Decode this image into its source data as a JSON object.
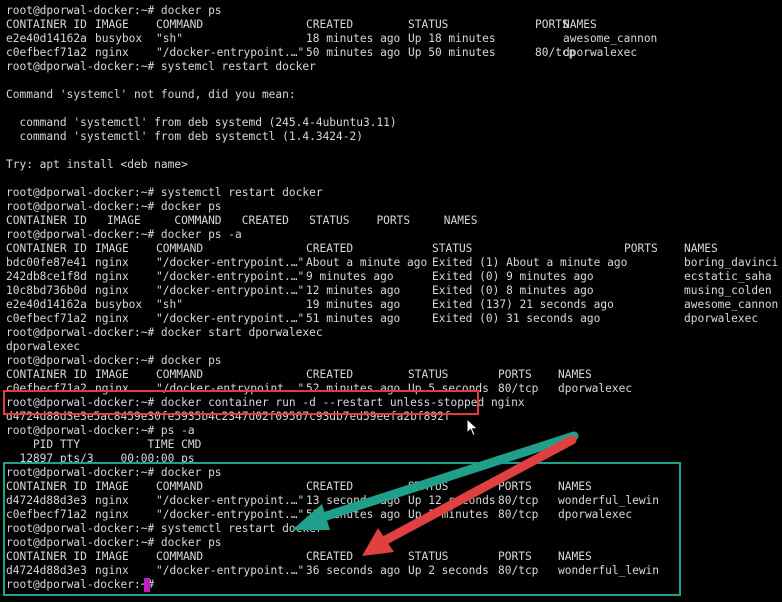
{
  "colors": {
    "background": "#000000",
    "foreground": "#d8d8d8",
    "cursor": "#c020c0",
    "highlight_red": "#e23b3b",
    "highlight_green": "#20a08a",
    "arrow_green": "#20a08a",
    "arrow_red": "#e04040"
  },
  "icons": {
    "mouse_pointer": "arrow-cursor-icon",
    "green_arrow": "arrow-annotation-icon",
    "red_arrow": "arrow-annotation-icon"
  },
  "terminal": {
    "lines": [
      {
        "cells": [
          {
            "t": "root@dporwal-docker:~# docker ps"
          }
        ]
      },
      {
        "cells": [
          {
            "t": "CONTAINER ID"
          },
          {
            "t": "IMAGE"
          },
          {
            "t": "COMMAND"
          },
          {
            "t": "CREATED"
          },
          {
            "t": "STATUS"
          },
          {
            "t": "PORTS"
          },
          {
            "t": "NAMES"
          }
        ]
      },
      {
        "cells": [
          {
            "t": "e2e40d14162a"
          },
          {
            "t": "busybox"
          },
          {
            "t": "\"sh\""
          },
          {
            "t": "18 minutes ago"
          },
          {
            "t": "Up 18 minutes"
          },
          {
            "t": "awesome_cannon"
          }
        ]
      },
      {
        "cells": [
          {
            "t": "c0efbecf71a2"
          },
          {
            "t": "nginx"
          },
          {
            "t": "\"/docker-entrypoint.…\""
          },
          {
            "t": "50 minutes ago"
          },
          {
            "t": "Up 50 minutes"
          },
          {
            "t": "80/tcp"
          },
          {
            "t": "dporwalexec"
          }
        ]
      },
      {
        "cells": [
          {
            "t": "root@dporwal-docker:~# systemcl restart docker"
          }
        ]
      },
      {
        "cells": []
      },
      {
        "cells": [
          {
            "t": "Command 'systemcl' not found, did you mean:"
          }
        ]
      },
      {
        "cells": []
      },
      {
        "cells": [
          {
            "t": "  command 'systemctl' from deb systemd (245.4-4ubuntu3.11)"
          }
        ]
      },
      {
        "cells": [
          {
            "t": "  command 'systemctl' from deb systemctl (1.4.3424-2)"
          }
        ]
      },
      {
        "cells": []
      },
      {
        "cells": [
          {
            "t": "Try: apt install <deb name>"
          }
        ]
      },
      {
        "cells": []
      },
      {
        "cells": [
          {
            "t": "root@dporwal-docker:~# systemctl restart docker"
          }
        ]
      },
      {
        "cells": [
          {
            "t": "root@dporwal-docker:~# docker ps"
          }
        ]
      },
      {
        "cells": [
          {
            "t": "CONTAINER ID   IMAGE     COMMAND   CREATED   STATUS    PORTS     NAMES"
          }
        ]
      },
      {
        "cells": [
          {
            "t": "root@dporwal-docker:~# docker ps -a"
          }
        ]
      },
      {
        "cells": [
          {
            "t": "CONTAINER ID"
          },
          {
            "t": "IMAGE"
          },
          {
            "t": "COMMAND"
          },
          {
            "t": "CREATED"
          },
          {
            "t": "STATUS"
          },
          {
            "t": "PORTS"
          },
          {
            "t": "NAMES"
          }
        ]
      },
      {
        "cells": [
          {
            "t": "bdc00fe87e41"
          },
          {
            "t": "nginx"
          },
          {
            "t": "\"/docker-entrypoint.…\""
          },
          {
            "t": "About a minute ago"
          },
          {
            "t": "Exited (1) About a minute ago"
          },
          {
            "t": "boring_davinci"
          }
        ]
      },
      {
        "cells": [
          {
            "t": "242db8ce1f8d"
          },
          {
            "t": "nginx"
          },
          {
            "t": "\"/docker-entrypoint.…\""
          },
          {
            "t": "9 minutes ago"
          },
          {
            "t": "Exited (0) 9 minutes ago"
          },
          {
            "t": "ecstatic_saha"
          }
        ]
      },
      {
        "cells": [
          {
            "t": "10c8bd736b0d"
          },
          {
            "t": "nginx"
          },
          {
            "t": "\"/docker-entrypoint.…\""
          },
          {
            "t": "12 minutes ago"
          },
          {
            "t": "Exited (0) 8 minutes ago"
          },
          {
            "t": "musing_colden"
          }
        ]
      },
      {
        "cells": [
          {
            "t": "e2e40d14162a"
          },
          {
            "t": "busybox"
          },
          {
            "t": "\"sh\""
          },
          {
            "t": "19 minutes ago"
          },
          {
            "t": "Exited (137) 21 seconds ago"
          },
          {
            "t": "awesome_cannon"
          }
        ]
      },
      {
        "cells": [
          {
            "t": "c0efbecf71a2"
          },
          {
            "t": "nginx"
          },
          {
            "t": "\"/docker-entrypoint.…\""
          },
          {
            "t": "51 minutes ago"
          },
          {
            "t": "Exited (0) 31 seconds ago"
          },
          {
            "t": "dporwalexec"
          }
        ]
      },
      {
        "cells": [
          {
            "t": "root@dporwal-docker:~# docker start dporwalexec"
          }
        ]
      },
      {
        "cells": [
          {
            "t": "dporwalexec"
          }
        ]
      },
      {
        "cells": [
          {
            "t": "root@dporwal-docker:~# docker ps"
          }
        ]
      },
      {
        "cells": [
          {
            "t": "CONTAINER ID"
          },
          {
            "t": "IMAGE"
          },
          {
            "t": "COMMAND"
          },
          {
            "t": "CREATED"
          },
          {
            "t": "STATUS"
          },
          {
            "t": "PORTS"
          },
          {
            "t": "NAMES"
          }
        ]
      },
      {
        "cells": [
          {
            "t": "c0efbecf71a2"
          },
          {
            "t": "nginx"
          },
          {
            "t": "\"/docker-entrypoint.…\""
          },
          {
            "t": "52 minutes ago"
          },
          {
            "t": "Up 5 seconds"
          },
          {
            "t": "80/tcp"
          },
          {
            "t": "dporwalexec"
          }
        ]
      },
      {
        "cells": [
          {
            "t": "root@dporwal-docker:~# docker container run -d --restart unless-stopped nginx"
          }
        ]
      },
      {
        "cells": [
          {
            "t": "d4724d88d3e3e5ac8459e30fe5935b4c2347d02f09567c93db7ed59eefa2bf892f"
          }
        ]
      },
      {
        "cells": [
          {
            "t": "root@dporwal-docker:~# ps -a"
          }
        ]
      },
      {
        "cells": [
          {
            "t": "    PID TTY          TIME CMD"
          }
        ]
      },
      {
        "cells": [
          {
            "t": "  12897 pts/3    00:00:00 ps"
          }
        ]
      },
      {
        "cells": [
          {
            "t": "root@dporwal-docker:~# docker ps"
          }
        ]
      },
      {
        "cells": [
          {
            "t": "CONTAINER ID"
          },
          {
            "t": "IMAGE"
          },
          {
            "t": "COMMAND"
          },
          {
            "t": "CREATED"
          },
          {
            "t": "STATUS"
          },
          {
            "t": "PORTS"
          },
          {
            "t": "NAMES"
          }
        ]
      },
      {
        "cells": [
          {
            "t": "d4724d88d3e3"
          },
          {
            "t": "nginx"
          },
          {
            "t": "\"/docker-entrypoint.…\""
          },
          {
            "t": "13 seconds ago"
          },
          {
            "t": "Up 12 seconds"
          },
          {
            "t": "80/tcp"
          },
          {
            "t": "wonderful_lewin"
          }
        ]
      },
      {
        "cells": [
          {
            "t": "c0efbecf71a2"
          },
          {
            "t": "nginx"
          },
          {
            "t": "\"/docker-entrypoint.…\""
          },
          {
            "t": "52 minutes ago"
          },
          {
            "t": "Up 3 minutes"
          },
          {
            "t": "80/tcp"
          },
          {
            "t": "dporwalexec"
          }
        ]
      },
      {
        "cells": [
          {
            "t": "root@dporwal-docker:~# systemctl restart docker"
          }
        ]
      },
      {
        "cells": [
          {
            "t": "root@dporwal-docker:~# docker ps"
          }
        ]
      },
      {
        "cells": [
          {
            "t": "CONTAINER ID"
          },
          {
            "t": "IMAGE"
          },
          {
            "t": "COMMAND"
          },
          {
            "t": "CREATED"
          },
          {
            "t": "STATUS"
          },
          {
            "t": "PORTS"
          },
          {
            "t": "NAMES"
          }
        ]
      },
      {
        "cells": [
          {
            "t": "d4724d88d3e3"
          },
          {
            "t": "nginx"
          },
          {
            "t": "\"/docker-entrypoint.…\""
          },
          {
            "t": "36 seconds ago"
          },
          {
            "t": "Up 2 seconds"
          },
          {
            "t": "80/tcp"
          },
          {
            "t": "wonderful_lewin"
          }
        ]
      },
      {
        "cells": [
          {
            "t": "root@dporwal-docker:~# "
          }
        ]
      }
    ]
  }
}
